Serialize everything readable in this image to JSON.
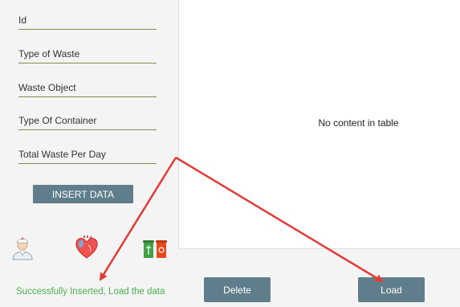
{
  "form": {
    "fields": [
      {
        "placeholder": "Id",
        "value": ""
      },
      {
        "placeholder": "Type of Waste",
        "value": ""
      },
      {
        "placeholder": "Waste Object",
        "value": ""
      },
      {
        "placeholder": "Type Of Container",
        "value": ""
      },
      {
        "placeholder": "Total Waste Per Day",
        "value": ""
      }
    ],
    "insert_label": "INSERT DATA"
  },
  "table": {
    "placeholder": "No content in table"
  },
  "icons": [
    "doctor-icon",
    "organ-icon",
    "bins-icon"
  ],
  "status": {
    "message": "Successfully Inserted, Load the data",
    "color": "#4caf50"
  },
  "actions": {
    "delete_label": "Delete",
    "load_label": "Load"
  },
  "annotation": {
    "arrow_color": "#e53935"
  }
}
